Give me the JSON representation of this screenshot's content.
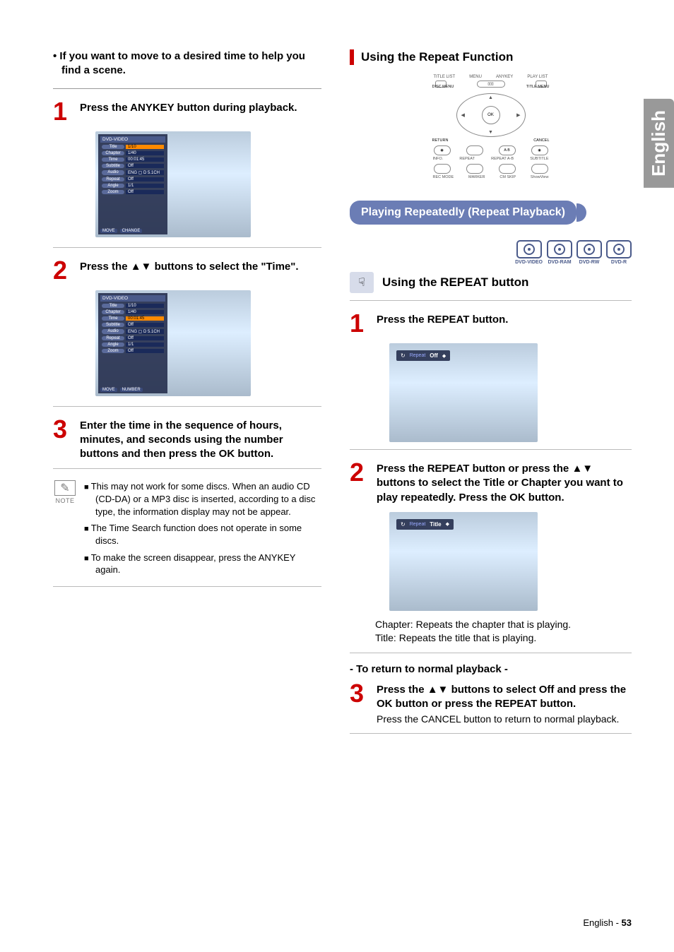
{
  "language_tab": "English",
  "footer": {
    "prefix": "English - ",
    "page": "53"
  },
  "left": {
    "intro": "• If you want to move to a desired time to help you find a scene.",
    "steps": {
      "1": {
        "title": "Press the ANYKEY button during playback."
      },
      "2": {
        "title": "Press the ▲▼ buttons to select the \"Time\"."
      },
      "3": {
        "title": "Enter the time in the sequence of hours, minutes, and seconds using the number buttons and then press the OK button."
      }
    },
    "osd": {
      "header": "DVD-VIDEO",
      "title_k": "Title",
      "title_v": "1/10",
      "chapter_k": "Chapter",
      "chapter_v": "1/40",
      "time_k": "Time",
      "time_v": "00:01:45",
      "subtitle_k": "Subtitle",
      "subtitle_v": "Off",
      "audio_k": "Audio",
      "audio_v": "ENG ▢ D 5.1CH",
      "repeat_k": "Repeat",
      "repeat_v": "Off",
      "angle_k": "Angle",
      "angle_v": "1/1",
      "zoom_k": "Zoom",
      "zoom_v": "Off",
      "footer1_move": "MOVE",
      "footer1_change": "CHANGE",
      "footer2_move": "MOVE",
      "footer2_number": "NUMBER"
    },
    "note_label": "NOTE",
    "notes": {
      "n1": "This may not work for some discs. When an audio CD (CD-DA) or a MP3 disc is inserted, according to a disc type, the information display may not be appear.",
      "n2": "The Time Search function does not operate in some discs.",
      "n3": "To make the screen disappear, press the ANYKEY again."
    }
  },
  "right": {
    "section_title": "Using the Repeat Function",
    "remote": {
      "top_labels": {
        "a": "TITLE LIST",
        "b": "MENU",
        "c": "ANYKEY",
        "d": "PLAY LIST"
      },
      "side": {
        "left": "DISC MENU",
        "right": "TITLE MENU"
      },
      "ok": "OK",
      "corners": {
        "return": "RETURN",
        "cancel": "CANCEL"
      },
      "row_labels": {
        "a": "INFO.",
        "b": "REPEAT",
        "c": "REPEAT A-B",
        "d": "SUBTITLE"
      },
      "row_labels2": {
        "a": "REC MODE",
        "b": "MARKER",
        "c": "CM SKIP",
        "d": "ShowView"
      },
      "ab": "A-B"
    },
    "subsection_title": "Playing Repeatedly (Repeat Playback)",
    "disc_labels": {
      "a": "DVD-VIDEO",
      "b": "DVD-RAM",
      "c": "DVD-RW",
      "d": "DVD-R"
    },
    "subhead": "Using the REPEAT button",
    "steps": {
      "1": {
        "title": "Press the REPEAT button."
      },
      "2": {
        "title": "Press the REPEAT button or press the ▲▼ buttons to select the Title or Chapter you want to play repeatedly. Press the OK button."
      },
      "2_desc": {
        "a": "Chapter: Repeats the chapter that is playing.",
        "b": "Title: Repeats the title that is playing."
      },
      "3": {
        "title": "Press the ▲▼ buttons to select Off and press the OK button or press the REPEAT button.",
        "text": "Press the CANCEL button to return to normal playback."
      }
    },
    "return_normal": "- To return to normal playback -",
    "repeat_bar": {
      "label": "Repeat",
      "val_off": "Off",
      "val_title": "Title",
      "arrows": "◆"
    }
  }
}
